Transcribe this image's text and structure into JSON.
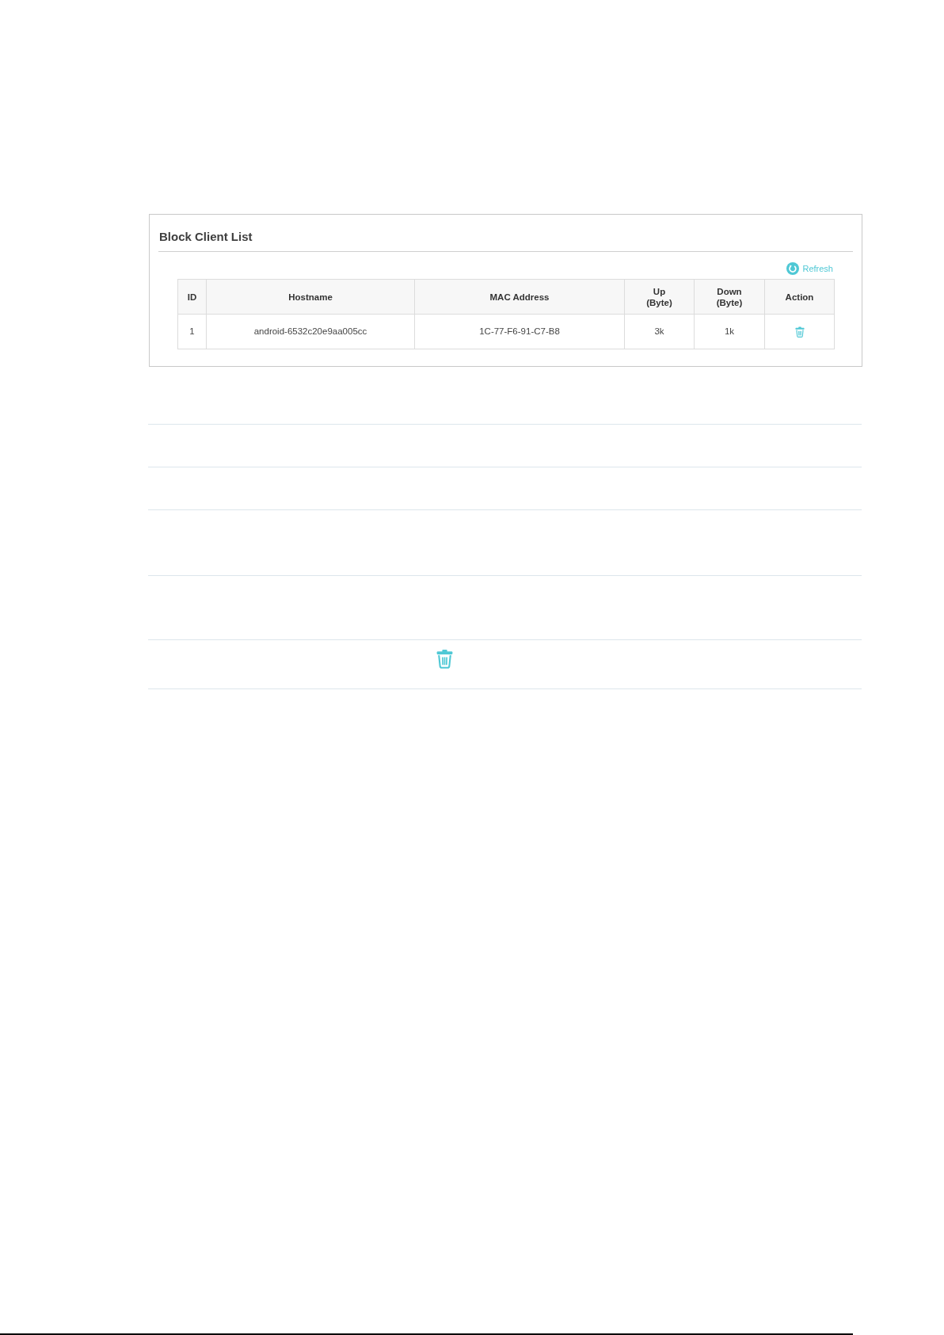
{
  "panel": {
    "title": "Block Client List",
    "refresh_button": {
      "label": "Refresh"
    },
    "table": {
      "columns": [
        {
          "label": "ID"
        },
        {
          "label": "Hostname"
        },
        {
          "label": "MAC Address"
        },
        {
          "label": "Up",
          "unit": "(Byte)"
        },
        {
          "label": "Down",
          "unit": "(Byte)"
        },
        {
          "label": "Action"
        }
      ],
      "rows": [
        {
          "cells": [
            "1",
            "android-6532c20e9aa005cc",
            "1C-77-F6-91-C7-B8",
            "3k",
            "1k"
          ],
          "kind": "delete"
        }
      ]
    }
  },
  "lower_list": {
    "rows": [
      {
        "kind": "blank"
      },
      {
        "kind": "blank"
      },
      {
        "kind": "blank"
      },
      {
        "kind": "blank"
      },
      {
        "kind": "delete"
      }
    ]
  }
}
